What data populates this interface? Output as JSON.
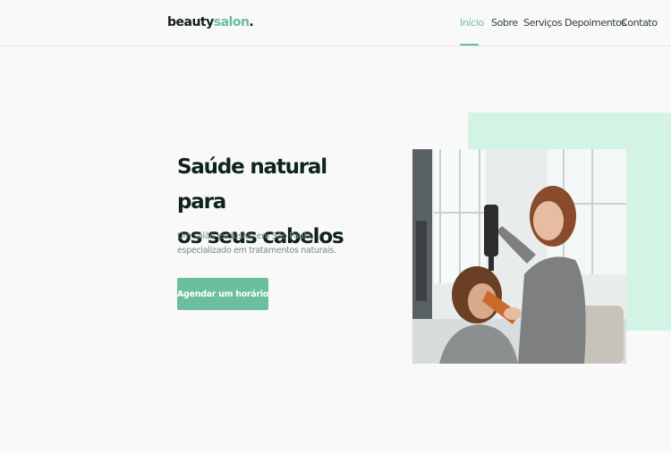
{
  "brand": {
    "logo_main": "beauty",
    "logo_accent": "salon",
    "logo_dot": ".",
    "accent_color": "#6bbf9c",
    "mint_color": "#d3f3e5"
  },
  "nav": {
    "items": [
      {
        "label": "Início",
        "active": true
      },
      {
        "label": "Sobre"
      },
      {
        "label": "Serviços"
      },
      {
        "label": "Depoimentos"
      },
      {
        "label": "Contato"
      }
    ]
  },
  "hero": {
    "title_line1": "Saúde natural para",
    "title_line2": "os seus cabelos",
    "subtitle": "Um salão exclusivo em São Paulo, especializado em tratamentos naturais.",
    "cta_label": "Agendar um horário"
  }
}
